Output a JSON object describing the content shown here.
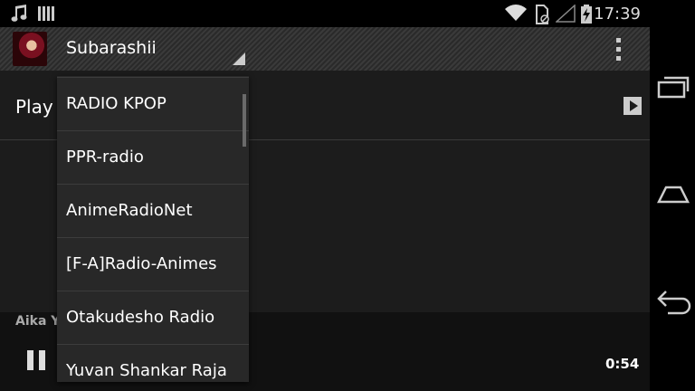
{
  "status_bar": {
    "time": "17:39",
    "icons": [
      "music-note-icon",
      "signal-bars-icon",
      "wifi-icon",
      "no-sim-icon",
      "cell-signal-icon",
      "battery-charging-icon"
    ]
  },
  "action_bar": {
    "selected_station": "Subarashii"
  },
  "main": {
    "play_row_label": "Play",
    "now_playing_artist": "Aika Y",
    "elapsed_time": "0:54"
  },
  "dropdown": {
    "items": [
      {
        "label": "RADIO KPOP"
      },
      {
        "label": "PPR-radio"
      },
      {
        "label": "AnimeRadioNet"
      },
      {
        "label": "[F-A]Radio-Animes"
      },
      {
        "label": "Otakudesho Radio"
      },
      {
        "label": "Yuvan Shankar Raja"
      }
    ]
  },
  "nav_bar": {
    "icons": [
      "recent-apps-icon",
      "home-icon",
      "back-icon"
    ]
  },
  "colors": {
    "background": "#1c1c1c",
    "dropdown_bg": "#282828",
    "divider": "#3a3a3a"
  }
}
